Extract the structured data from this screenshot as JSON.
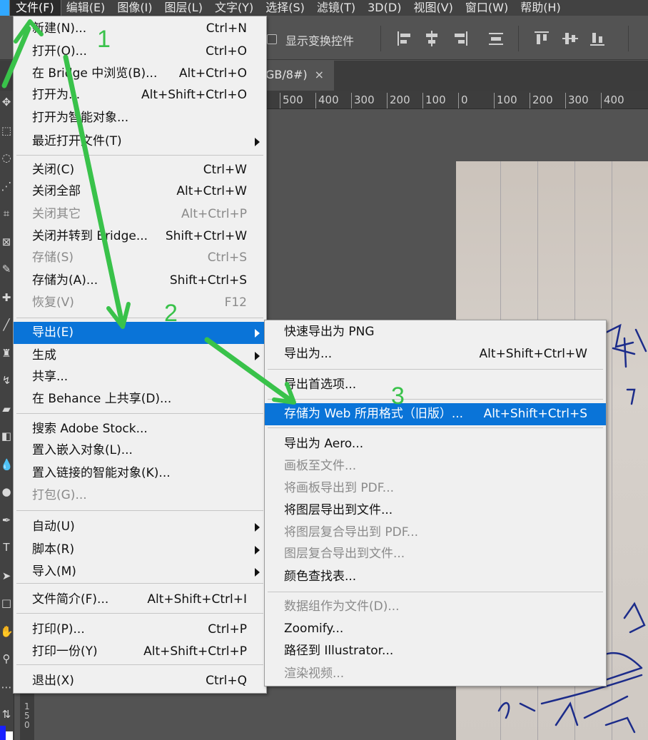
{
  "menubar": {
    "items": [
      "文件(F)",
      "编辑(E)",
      "图像(I)",
      "图层(L)",
      "文字(Y)",
      "选择(S)",
      "滤镜(T)",
      "3D(D)",
      "视图(V)",
      "窗口(W)",
      "帮助(H)"
    ],
    "active_index": 0
  },
  "options_bar": {
    "show_transform_controls": "显示变换控件"
  },
  "document_tab": {
    "title_fragment": "GB/8#)",
    "close": "×"
  },
  "ruler": {
    "ticks": [
      "500",
      "400",
      "300",
      "200",
      "100",
      "0",
      "100",
      "200",
      "300",
      "400"
    ]
  },
  "vruler_text": "150",
  "file_menu": {
    "items": [
      {
        "label": "新建(N)...",
        "shortcut": "Ctrl+N"
      },
      {
        "label": "打开(O)...",
        "shortcut": "Ctrl+O"
      },
      {
        "label": "在 Bridge 中浏览(B)...",
        "shortcut": "Alt+Ctrl+O"
      },
      {
        "label": "打开为...",
        "shortcut": "Alt+Shift+Ctrl+O"
      },
      {
        "label": "打开为智能对象...",
        "shortcut": ""
      },
      {
        "label": "最近打开文件(T)",
        "shortcut": "",
        "submenu": true
      },
      {
        "label": "关闭(C)",
        "shortcut": "Ctrl+W"
      },
      {
        "label": "关闭全部",
        "shortcut": "Alt+Ctrl+W"
      },
      {
        "label": "关闭其它",
        "shortcut": "Alt+Ctrl+P",
        "disabled": true
      },
      {
        "label": "关闭并转到 Bridge...",
        "shortcut": "Shift+Ctrl+W"
      },
      {
        "label": "存储(S)",
        "shortcut": "Ctrl+S",
        "disabled": true
      },
      {
        "label": "存储为(A)...",
        "shortcut": "Shift+Ctrl+S"
      },
      {
        "label": "恢复(V)",
        "shortcut": "F12",
        "disabled": true
      },
      {
        "label": "导出(E)",
        "shortcut": "",
        "submenu": true,
        "highlight": true
      },
      {
        "label": "生成",
        "shortcut": "",
        "submenu": true
      },
      {
        "label": "共享...",
        "shortcut": ""
      },
      {
        "label": "在 Behance 上共享(D)...",
        "shortcut": ""
      },
      {
        "label": "搜索 Adobe Stock...",
        "shortcut": ""
      },
      {
        "label": "置入嵌入对象(L)...",
        "shortcut": ""
      },
      {
        "label": "置入链接的智能对象(K)...",
        "shortcut": ""
      },
      {
        "label": "打包(G)...",
        "shortcut": "",
        "disabled": true
      },
      {
        "label": "自动(U)",
        "shortcut": "",
        "submenu": true
      },
      {
        "label": "脚本(R)",
        "shortcut": "",
        "submenu": true
      },
      {
        "label": "导入(M)",
        "shortcut": "",
        "submenu": true
      },
      {
        "label": "文件简介(F)...",
        "shortcut": "Alt+Shift+Ctrl+I"
      },
      {
        "label": "打印(P)...",
        "shortcut": "Ctrl+P"
      },
      {
        "label": "打印一份(Y)",
        "shortcut": "Alt+Shift+Ctrl+P"
      },
      {
        "label": "退出(X)",
        "shortcut": "Ctrl+Q"
      }
    ]
  },
  "export_menu": {
    "items": [
      {
        "label": "快速导出为 PNG",
        "shortcut": ""
      },
      {
        "label": "导出为...",
        "shortcut": "Alt+Shift+Ctrl+W"
      },
      {
        "label": "导出首选项...",
        "shortcut": ""
      },
      {
        "label": "存储为 Web 所用格式（旧版）...",
        "shortcut": "Alt+Shift+Ctrl+S",
        "highlight": true
      },
      {
        "label": "导出为 Aero...",
        "shortcut": ""
      },
      {
        "label": "画板至文件...",
        "shortcut": "",
        "disabled": true
      },
      {
        "label": "将画板导出到 PDF...",
        "shortcut": "",
        "disabled": true
      },
      {
        "label": "将图层导出到文件...",
        "shortcut": ""
      },
      {
        "label": "将图层复合导出到 PDF...",
        "shortcut": "",
        "disabled": true
      },
      {
        "label": "图层复合导出到文件...",
        "shortcut": "",
        "disabled": true
      },
      {
        "label": "颜色查找表...",
        "shortcut": ""
      },
      {
        "label": "数据组作为文件(D)...",
        "shortcut": "",
        "disabled": true
      },
      {
        "label": "Zoomify...",
        "shortcut": ""
      },
      {
        "label": "路径到 Illustrator...",
        "shortcut": ""
      },
      {
        "label": "渲染视频...",
        "shortcut": "",
        "disabled": true
      }
    ]
  },
  "annotations": {
    "steps": [
      "1",
      "2",
      "3"
    ],
    "color": "#39c24a"
  },
  "colors": {
    "highlight": "#0a74d8",
    "menu_bg": "#f0f0f0",
    "foreground_swatch": "#1a21ff",
    "background_swatch": "#ffffff"
  }
}
